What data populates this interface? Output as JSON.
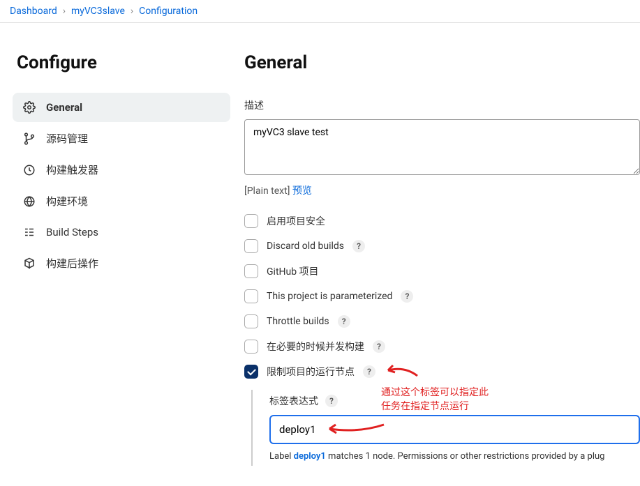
{
  "breadcrumb": {
    "items": [
      "Dashboard",
      "myVC3slave",
      "Configuration"
    ]
  },
  "sidebar": {
    "title": "Configure",
    "items": [
      {
        "label": "General",
        "icon": "gear-icon",
        "active": true
      },
      {
        "label": "源码管理",
        "icon": "branch-icon",
        "active": false
      },
      {
        "label": "构建触发器",
        "icon": "clock-icon",
        "active": false
      },
      {
        "label": "构建环境",
        "icon": "globe-icon",
        "active": false
      },
      {
        "label": "Build Steps",
        "icon": "steps-icon",
        "active": false
      },
      {
        "label": "构建后操作",
        "icon": "box-export-icon",
        "active": false
      }
    ]
  },
  "general": {
    "heading": "General",
    "description_label": "描述",
    "description_value": "myVC3 slave test",
    "plain_text_prefix": "[Plain text] ",
    "preview_label": "预览",
    "checks": [
      {
        "label": "启用项目安全",
        "help": false,
        "checked": false
      },
      {
        "label": "Discard old builds",
        "help": true,
        "checked": false
      },
      {
        "label": "GitHub 项目",
        "help": false,
        "checked": false
      },
      {
        "label": "This project is parameterized",
        "help": true,
        "checked": false
      },
      {
        "label": "Throttle builds",
        "help": true,
        "checked": false
      },
      {
        "label": "在必要的时候并发构建",
        "help": true,
        "checked": false
      },
      {
        "label": "限制项目的运行节点",
        "help": true,
        "checked": true
      }
    ],
    "label_expression": {
      "label": "标签表达式",
      "value": "deploy1",
      "validation_prefix": "Label ",
      "validation_bold": "deploy1",
      "validation_suffix": " matches 1 node. Permissions or other restrictions provided by a plug"
    }
  },
  "annotations": {
    "red_note": "通过这个标签可以指定此任务在指定节点运行"
  }
}
